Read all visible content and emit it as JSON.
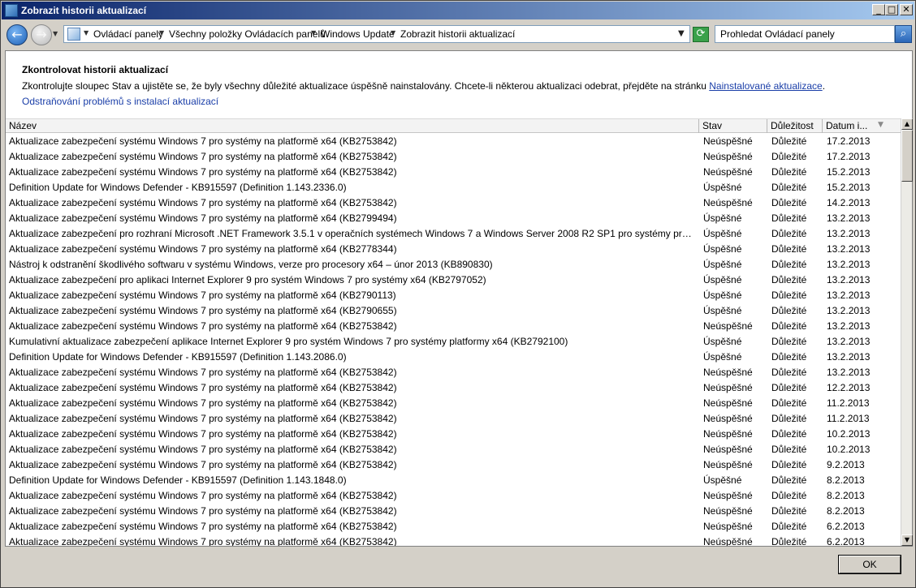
{
  "window": {
    "title": "Zobrazit historii aktualizací",
    "min_glyph": "_",
    "max_glyph": "□",
    "close_glyph": "✕"
  },
  "nav": {
    "back_glyph": "←",
    "forward_glyph": "→",
    "breadcrumbs": [
      "Ovládací panely",
      "Všechny položky Ovládacích panelů",
      "Windows Update",
      "Zobrazit historii aktualizací"
    ],
    "refresh_glyph": "⟳",
    "search_placeholder": "Prohledat Ovládací panely",
    "search_glyph": "⌕"
  },
  "page": {
    "heading": "Zkontrolovat historii aktualizací",
    "description_prefix": "Zkontrolujte sloupec Stav a ujistěte se, že byly všechny důležité aktualizace úspěšně nainstalovány. Chcete-li některou aktualizaci odebrat, přejděte na stránku ",
    "installed_link": "Nainstalované aktualizace",
    "description_suffix": ".",
    "troubleshoot_link": "Odstraňování problémů s instalací aktualizací"
  },
  "columns": {
    "name": "Název",
    "status": "Stav",
    "importance": "Důležitost",
    "date": "Datum i..."
  },
  "rows": [
    {
      "name": "Aktualizace zabezpečení systému Windows 7 pro systémy na platformě x64 (KB2753842)",
      "status": "Neúspěšné",
      "importance": "Důležité",
      "date": "17.2.2013"
    },
    {
      "name": "Aktualizace zabezpečení systému Windows 7 pro systémy na platformě x64 (KB2753842)",
      "status": "Neúspěšné",
      "importance": "Důležité",
      "date": "17.2.2013"
    },
    {
      "name": "Aktualizace zabezpečení systému Windows 7 pro systémy na platformě x64 (KB2753842)",
      "status": "Neúspěšné",
      "importance": "Důležité",
      "date": "15.2.2013"
    },
    {
      "name": "Definition Update for Windows Defender - KB915597 (Definition 1.143.2336.0)",
      "status": "Úspěšné",
      "importance": "Důležité",
      "date": "15.2.2013"
    },
    {
      "name": "Aktualizace zabezpečení systému Windows 7 pro systémy na platformě x64 (KB2753842)",
      "status": "Neúspěšné",
      "importance": "Důležité",
      "date": "14.2.2013"
    },
    {
      "name": "Aktualizace zabezpečení systému Windows 7 pro systémy na platformě x64 (KB2799494)",
      "status": "Úspěšné",
      "importance": "Důležité",
      "date": "13.2.2013"
    },
    {
      "name": "Aktualizace zabezpečení pro rozhraní Microsoft .NET Framework 3.5.1 v operačních systémech Windows 7 a Windows Server 2008 R2 SP1 pro systémy pro platf...",
      "status": "Úspěšné",
      "importance": "Důležité",
      "date": "13.2.2013"
    },
    {
      "name": "Aktualizace zabezpečení systému Windows 7 pro systémy na platformě x64 (KB2778344)",
      "status": "Úspěšné",
      "importance": "Důležité",
      "date": "13.2.2013"
    },
    {
      "name": "Nástroj k odstranění škodlivého softwaru v systému Windows, verze pro procesory x64 – únor 2013 (KB890830)",
      "status": "Úspěšné",
      "importance": "Důležité",
      "date": "13.2.2013"
    },
    {
      "name": "Aktualizace zabezpečení pro aplikaci Internet Explorer 9 pro systém Windows 7 pro systémy x64 (KB2797052)",
      "status": "Úspěšné",
      "importance": "Důležité",
      "date": "13.2.2013"
    },
    {
      "name": "Aktualizace zabezpečení systému Windows 7 pro systémy na platformě x64 (KB2790113)",
      "status": "Úspěšné",
      "importance": "Důležité",
      "date": "13.2.2013"
    },
    {
      "name": "Aktualizace zabezpečení systému Windows 7 pro systémy na platformě x64 (KB2790655)",
      "status": "Úspěšné",
      "importance": "Důležité",
      "date": "13.2.2013"
    },
    {
      "name": "Aktualizace zabezpečení systému Windows 7 pro systémy na platformě x64 (KB2753842)",
      "status": "Neúspěšné",
      "importance": "Důležité",
      "date": "13.2.2013"
    },
    {
      "name": "Kumulativní aktualizace zabezpečení aplikace Internet Explorer 9 pro systém Windows 7 pro systémy platformy x64 (KB2792100)",
      "status": "Úspěšné",
      "importance": "Důležité",
      "date": "13.2.2013"
    },
    {
      "name": "Definition Update for Windows Defender - KB915597 (Definition 1.143.2086.0)",
      "status": "Úspěšné",
      "importance": "Důležité",
      "date": "13.2.2013"
    },
    {
      "name": "Aktualizace zabezpečení systému Windows 7 pro systémy na platformě x64 (KB2753842)",
      "status": "Neúspěšné",
      "importance": "Důležité",
      "date": "13.2.2013"
    },
    {
      "name": "Aktualizace zabezpečení systému Windows 7 pro systémy na platformě x64 (KB2753842)",
      "status": "Neúspěšné",
      "importance": "Důležité",
      "date": "12.2.2013"
    },
    {
      "name": "Aktualizace zabezpečení systému Windows 7 pro systémy na platformě x64 (KB2753842)",
      "status": "Neúspěšné",
      "importance": "Důležité",
      "date": "11.2.2013"
    },
    {
      "name": "Aktualizace zabezpečení systému Windows 7 pro systémy na platformě x64 (KB2753842)",
      "status": "Neúspěšné",
      "importance": "Důležité",
      "date": "11.2.2013"
    },
    {
      "name": "Aktualizace zabezpečení systému Windows 7 pro systémy na platformě x64 (KB2753842)",
      "status": "Neúspěšné",
      "importance": "Důležité",
      "date": "10.2.2013"
    },
    {
      "name": "Aktualizace zabezpečení systému Windows 7 pro systémy na platformě x64 (KB2753842)",
      "status": "Neúspěšné",
      "importance": "Důležité",
      "date": "10.2.2013"
    },
    {
      "name": "Aktualizace zabezpečení systému Windows 7 pro systémy na platformě x64 (KB2753842)",
      "status": "Neúspěšné",
      "importance": "Důležité",
      "date": "9.2.2013"
    },
    {
      "name": "Definition Update for Windows Defender - KB915597 (Definition 1.143.1848.0)",
      "status": "Úspěšné",
      "importance": "Důležité",
      "date": "8.2.2013"
    },
    {
      "name": "Aktualizace zabezpečení systému Windows 7 pro systémy na platformě x64 (KB2753842)",
      "status": "Neúspěšné",
      "importance": "Důležité",
      "date": "8.2.2013"
    },
    {
      "name": "Aktualizace zabezpečení systému Windows 7 pro systémy na platformě x64 (KB2753842)",
      "status": "Neúspěšné",
      "importance": "Důležité",
      "date": "8.2.2013"
    },
    {
      "name": "Aktualizace zabezpečení systému Windows 7 pro systémy na platformě x64 (KB2753842)",
      "status": "Neúspěšné",
      "importance": "Důležité",
      "date": "6.2.2013"
    },
    {
      "name": "Aktualizace zabezpečení systému Windows 7 pro systémy na platformě x64 (KB2753842)",
      "status": "Neúspěšné",
      "importance": "Důležité",
      "date": "6.2.2013"
    }
  ],
  "scrollbar": {
    "up_glyph": "▲",
    "down_glyph": "▼"
  },
  "footer": {
    "ok_label": "OK"
  }
}
